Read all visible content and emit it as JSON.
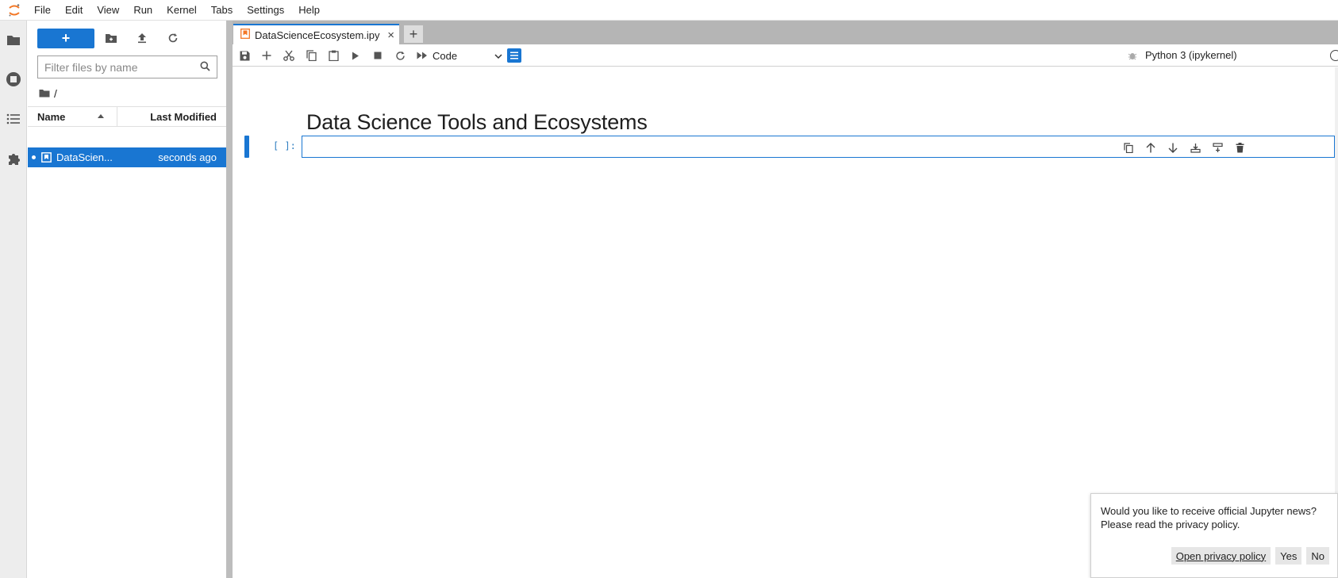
{
  "menubar": {
    "items": [
      "File",
      "Edit",
      "View",
      "Run",
      "Kernel",
      "Tabs",
      "Settings",
      "Help"
    ]
  },
  "activitybar": {
    "icons": [
      "folder-icon",
      "running-icon",
      "toc-icon",
      "extension-icon"
    ]
  },
  "filebrowser": {
    "new_label": "+",
    "filter_placeholder": "Filter files by name",
    "breadcrumb": "/",
    "columns": {
      "name": "Name",
      "modified": "Last Modified"
    },
    "files": [
      {
        "name": "DataScien...",
        "modified": "seconds ago"
      }
    ]
  },
  "tabs": {
    "active_label": "DataScienceEcosystem.ipy",
    "close": "×",
    "add": "+"
  },
  "toolbar": {
    "cell_type": "Code",
    "kernel_name": "Python 3 (ipykernel)"
  },
  "notebook": {
    "heading": "Data Science Tools and Ecosystems",
    "prompt": "[ ]:"
  },
  "notification": {
    "message_line1": "Would you like to receive official Jupyter news?",
    "message_line2": "Please read the privacy policy.",
    "privacy_link": "Open privacy policy",
    "yes": "Yes",
    "no": "No"
  },
  "colors": {
    "accent": "#1976d2",
    "jupyter_orange": "#f37726"
  }
}
